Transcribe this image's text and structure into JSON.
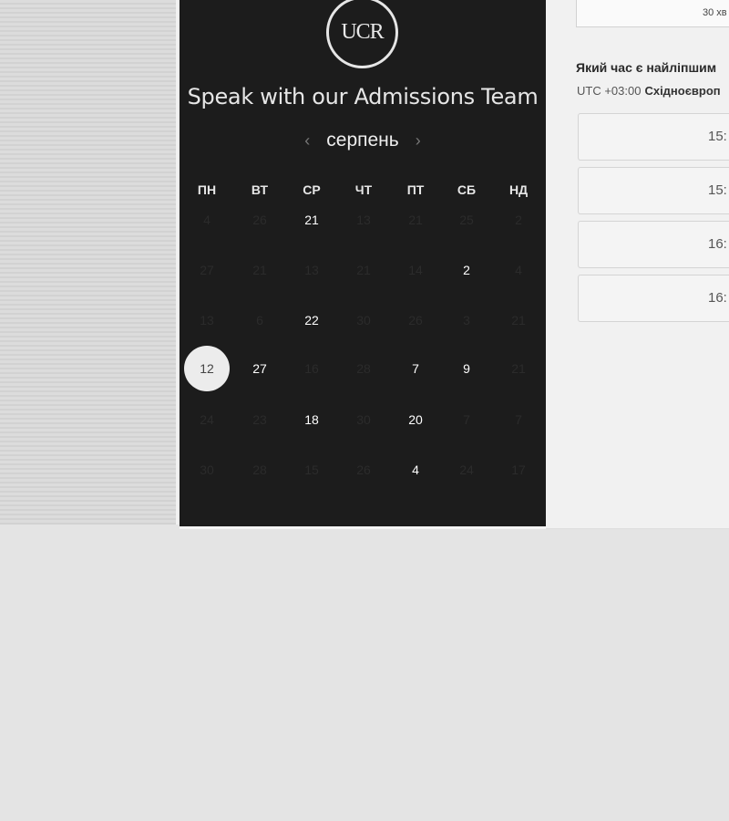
{
  "header": {
    "logo_text": "UCR",
    "title": "Speak with our Admissions Team"
  },
  "calendar": {
    "month": "серпень",
    "prev_icon": "chevron-left-icon",
    "next_icon": "chevron-right-icon",
    "weekdays": [
      "ПН",
      "ВТ",
      "СР",
      "ЧТ",
      "ПТ",
      "СБ",
      "НД"
    ],
    "weeks": [
      [
        {
          "d": "4",
          "s": "muted"
        },
        {
          "d": "26",
          "s": "muted"
        },
        {
          "d": "21",
          "s": "avail"
        },
        {
          "d": "13",
          "s": "muted"
        },
        {
          "d": "21",
          "s": "muted"
        },
        {
          "d": "25",
          "s": "muted"
        },
        {
          "d": "2",
          "s": "muted"
        }
      ],
      [
        {
          "d": "27",
          "s": "muted"
        },
        {
          "d": "21",
          "s": "muted"
        },
        {
          "d": "13",
          "s": "muted"
        },
        {
          "d": "21",
          "s": "muted"
        },
        {
          "d": "14",
          "s": "muted"
        },
        {
          "d": "2",
          "s": "avail"
        },
        {
          "d": "4",
          "s": "muted"
        }
      ],
      [
        {
          "d": "13",
          "s": "muted"
        },
        {
          "d": "6",
          "s": "muted"
        },
        {
          "d": "22",
          "s": "avail"
        },
        {
          "d": "30",
          "s": "muted"
        },
        {
          "d": "26",
          "s": "muted"
        },
        {
          "d": "3",
          "s": "muted"
        },
        {
          "d": "21",
          "s": "muted"
        }
      ],
      [
        {
          "d": "12",
          "s": "selected"
        },
        {
          "d": "27",
          "s": "avail"
        },
        {
          "d": "16",
          "s": "muted"
        },
        {
          "d": "28",
          "s": "muted"
        },
        {
          "d": "7",
          "s": "avail"
        },
        {
          "d": "9",
          "s": "avail"
        },
        {
          "d": "21",
          "s": "muted"
        }
      ],
      [
        {
          "d": "24",
          "s": "muted"
        },
        {
          "d": "23",
          "s": "muted"
        },
        {
          "d": "18",
          "s": "avail"
        },
        {
          "d": "30",
          "s": "muted"
        },
        {
          "d": "20",
          "s": "avail"
        },
        {
          "d": "7",
          "s": "muted"
        },
        {
          "d": "7",
          "s": "muted"
        }
      ],
      [
        {
          "d": "30",
          "s": "muted"
        },
        {
          "d": "28",
          "s": "muted"
        },
        {
          "d": "15",
          "s": "muted"
        },
        {
          "d": "26",
          "s": "muted"
        },
        {
          "d": "4",
          "s": "avail"
        },
        {
          "d": "24",
          "s": "muted"
        },
        {
          "d": "17",
          "s": "muted"
        }
      ]
    ]
  },
  "booking": {
    "duration": "30 хв",
    "question": "Який час є найліпшим",
    "tz_offset": "UTC +03:00",
    "tz_name": "Східноєвроп",
    "slots": [
      "15:",
      "15:",
      "16:",
      "16:"
    ]
  },
  "colors": {
    "panel_bg": "#1c1c1c",
    "selected_day_bg": "#ececec",
    "page_bg": "#e4e4e4"
  }
}
